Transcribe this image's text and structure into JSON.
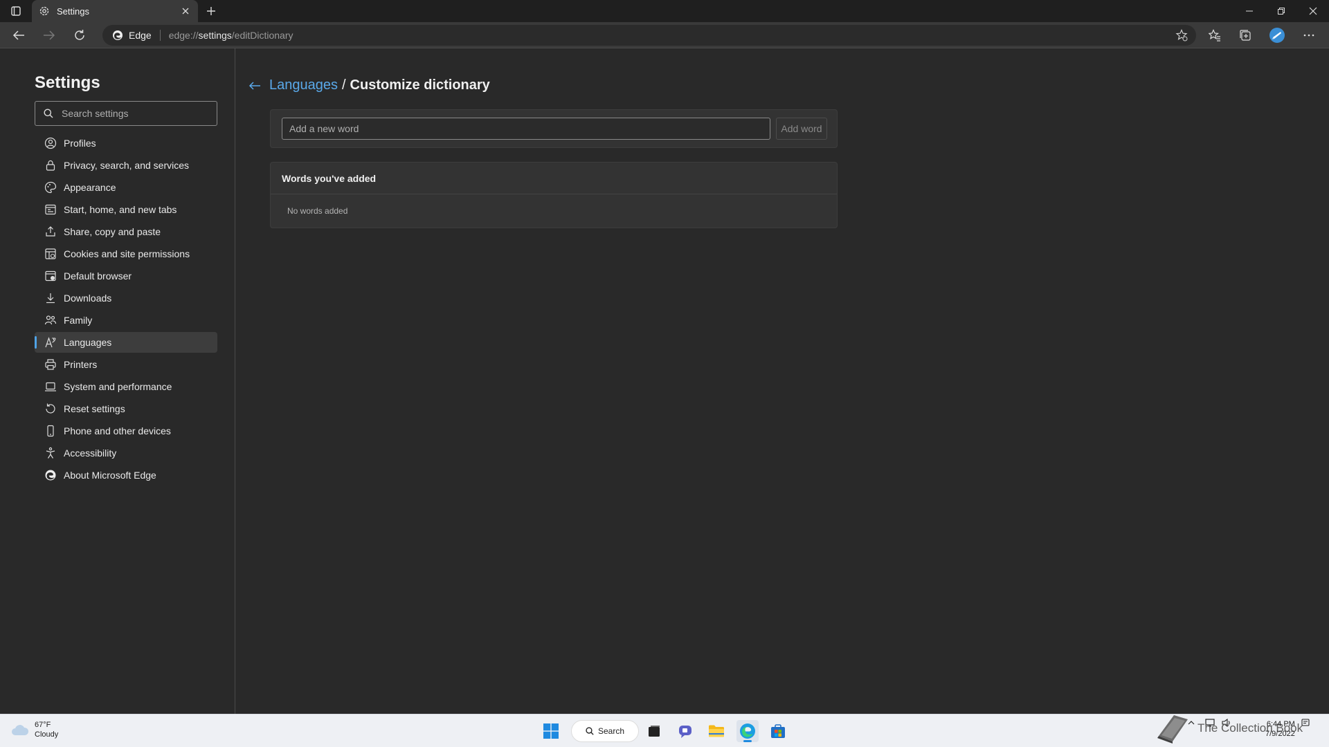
{
  "window": {
    "tab_title": "Settings"
  },
  "toolbar": {
    "brand": "Edge",
    "url_prefix": "edge://",
    "url_host": "settings",
    "url_path": "/editDictionary"
  },
  "sidebar": {
    "title": "Settings",
    "search_placeholder": "Search settings",
    "items": [
      {
        "label": "Profiles",
        "icon": "profile-icon"
      },
      {
        "label": "Privacy, search, and services",
        "icon": "lock-icon"
      },
      {
        "label": "Appearance",
        "icon": "palette-icon"
      },
      {
        "label": "Start, home, and new tabs",
        "icon": "home-tabs-icon"
      },
      {
        "label": "Share, copy and paste",
        "icon": "share-icon"
      },
      {
        "label": "Cookies and site permissions",
        "icon": "cookie-icon"
      },
      {
        "label": "Default browser",
        "icon": "browser-icon"
      },
      {
        "label": "Downloads",
        "icon": "download-icon"
      },
      {
        "label": "Family",
        "icon": "family-icon"
      },
      {
        "label": "Languages",
        "icon": "language-icon",
        "active": true
      },
      {
        "label": "Printers",
        "icon": "printer-icon"
      },
      {
        "label": "System and performance",
        "icon": "laptop-icon"
      },
      {
        "label": "Reset settings",
        "icon": "reset-icon"
      },
      {
        "label": "Phone and other devices",
        "icon": "phone-icon"
      },
      {
        "label": "Accessibility",
        "icon": "accessibility-icon"
      },
      {
        "label": "About Microsoft Edge",
        "icon": "edge-logo-icon"
      }
    ]
  },
  "main": {
    "breadcrumb_parent": "Languages",
    "breadcrumb_sep": "/",
    "breadcrumb_current": "Customize dictionary",
    "add_placeholder": "Add a new word",
    "add_button": "Add word",
    "words_header": "Words you've added",
    "words_empty": "No words added"
  },
  "taskbar": {
    "temperature": "67°F",
    "condition": "Cloudy",
    "search_label": "Search",
    "time": "6:44 PM",
    "date": "7/9/2022",
    "watermark": "The Collection Book"
  },
  "colors": {
    "accent": "#4fa3e6",
    "link": "#5aa9ea",
    "background": "#292929"
  }
}
